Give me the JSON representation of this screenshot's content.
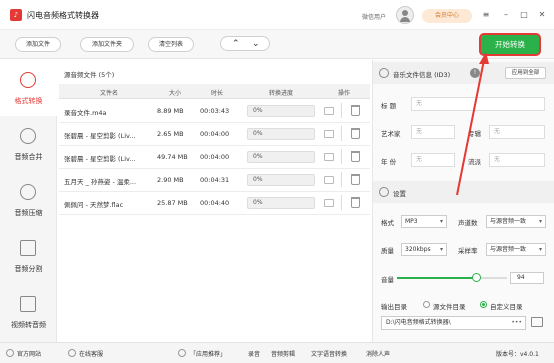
{
  "window": {
    "title": "闪电音频格式转换器",
    "logo_glyph": "♪",
    "user_label": "微信用户",
    "vip_label": "会员中心",
    "minimize": "–",
    "maximize": "□",
    "close": "✕"
  },
  "toolbar": {
    "add_file": "添加文件",
    "add_folder": "添加文件夹",
    "clear_list": "清空列表",
    "up_glyph": "⌃",
    "down_glyph": "⌄",
    "start": "开始转换"
  },
  "sidebar": {
    "items": [
      {
        "label": "格式转换",
        "icon": "refresh-icon",
        "active": true
      },
      {
        "label": "音频合并",
        "icon": "merge-icon",
        "active": false
      },
      {
        "label": "音频压缩",
        "icon": "compress-icon",
        "active": false
      },
      {
        "label": "音频分割",
        "icon": "split-icon",
        "active": false
      },
      {
        "label": "视频转音频",
        "icon": "video-play-icon",
        "active": false
      }
    ]
  },
  "filelist": {
    "title": "源音频文件 (5个)",
    "headers": {
      "name": "文件名",
      "size": "大小",
      "duration": "时长",
      "progress": "转换进度",
      "action": "操作"
    },
    "rows": [
      {
        "name": "录音文件.m4a",
        "size": "8.89 MB",
        "duration": "00:03:43",
        "progress": "0%"
      },
      {
        "name": "张碧晨 - 星空剪影 (Liv...",
        "size": "2.65 MB",
        "duration": "00:04:00",
        "progress": "0%"
      },
      {
        "name": "张碧晨 - 星空剪影 (Liv...",
        "size": "49.74 MB",
        "duration": "00:04:00",
        "progress": "0%"
      },
      {
        "name": "五月天 _ 孙燕姿 - 温柔...",
        "size": "2.90 MB",
        "duration": "00:04:31",
        "progress": "0%"
      },
      {
        "name": "佩佩问 - 天然梦.flac",
        "size": "25.87 MB",
        "duration": "00:04:40",
        "progress": "0%"
      }
    ]
  },
  "info": {
    "title": "音乐文件信息 (ID3)",
    "help": "!",
    "apply_all": "应用到全部",
    "title_label": "标   题",
    "title_value": "无",
    "artist_label": "艺术家",
    "artist_value": "无",
    "album_label": "专辑",
    "album_value": "无",
    "year_label": "年   份",
    "year_value": "无",
    "genre_label": "流派",
    "genre_value": "无"
  },
  "settings": {
    "title": "设置",
    "format_label": "格式",
    "format_value": "MP3",
    "channels_label": "声道数",
    "channels_value": "与源音频一致",
    "quality_label": "质量",
    "quality_value": "320kbps",
    "samplerate_label": "采样率",
    "samplerate_value": "与源音频一致",
    "volume_label": "音量",
    "volume_value": "94",
    "volume_level": 0.72,
    "output_label": "输出目录",
    "output_opt_source": "源文件目录",
    "output_opt_custom": "自定义目录",
    "output_path": "D:\\闪电音频格式转换器\\",
    "more": "•••"
  },
  "statusbar": {
    "website": "官方网站",
    "support": "在线客服",
    "recommend": "「应用推荐」",
    "record": "录音",
    "cut": "音频剪辑",
    "tts": "文字语音转换",
    "denoise": "消除人声",
    "version": "版本号：v4.0.1"
  },
  "colors": {
    "accent_green": "#2bb14a",
    "highlight_red": "#e53935",
    "vip_orange": "#d57a2a"
  }
}
